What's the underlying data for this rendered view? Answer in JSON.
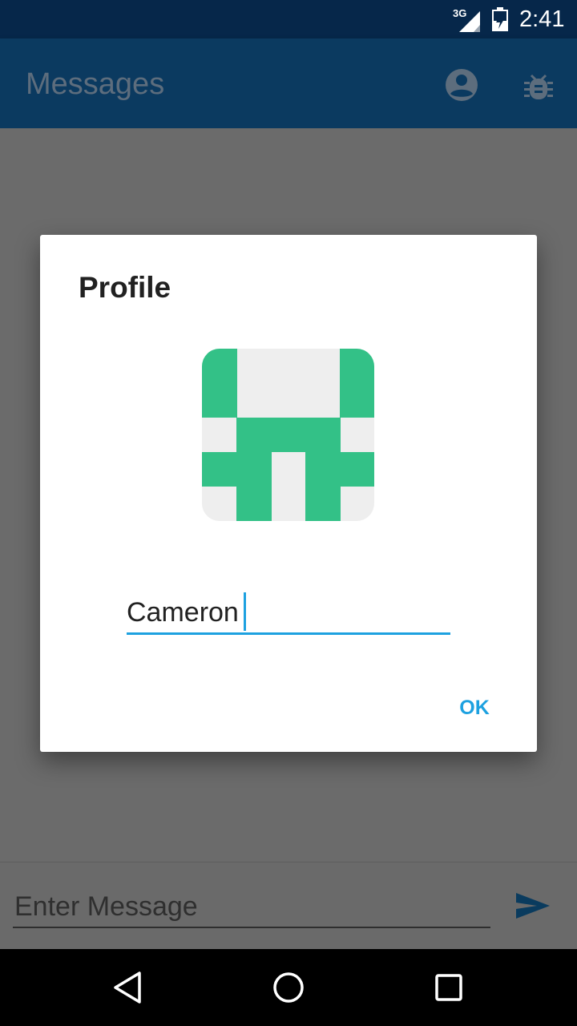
{
  "status_bar": {
    "network": "3G",
    "time": "2:41"
  },
  "app_bar": {
    "title": "Messages",
    "icons": [
      "account-circle-icon",
      "bug-icon"
    ]
  },
  "dialog": {
    "title": "Profile",
    "name_value": "Cameron",
    "ok_label": "OK",
    "avatar_colors": {
      "fill": "#33c187",
      "background": "#eeeeee"
    }
  },
  "composer": {
    "placeholder": "Enter Message",
    "send_icon": "send-icon"
  },
  "nav_bar": {
    "icons": [
      "back-icon",
      "home-icon",
      "recents-icon"
    ]
  },
  "colors": {
    "status_bar": "#06274a",
    "app_bar": "#0b3a60",
    "accent": "#1da1e0",
    "scrim": "#6b6b6b"
  }
}
